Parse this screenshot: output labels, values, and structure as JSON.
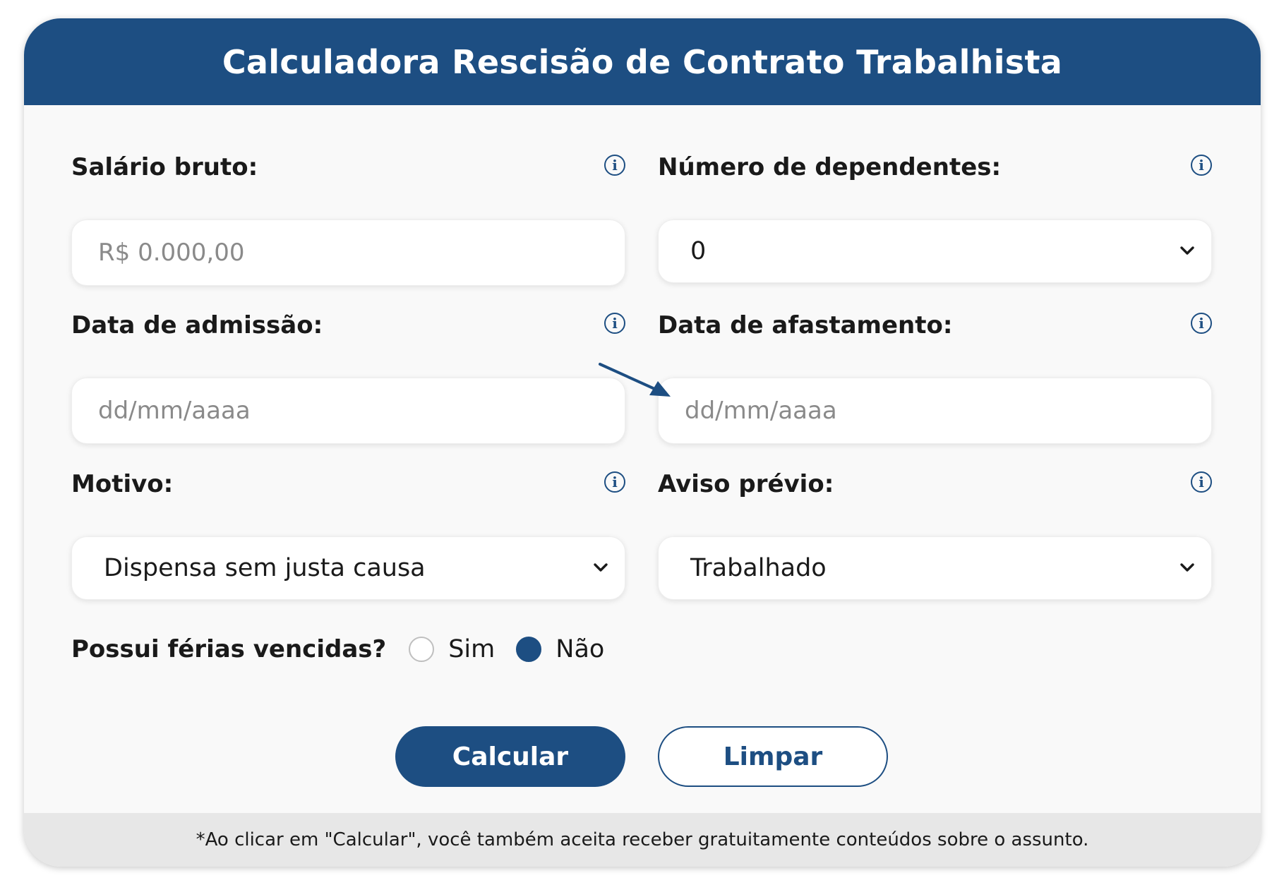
{
  "header": {
    "title": "Calculadora Rescisão de Contrato Trabalhista"
  },
  "fields": {
    "salario": {
      "label": "Salário bruto:",
      "placeholder": "R$ 0.000,00"
    },
    "dependentes": {
      "label": "Número de dependentes:",
      "selected": "0"
    },
    "admissao": {
      "label": "Data de admissão:",
      "placeholder": "dd/mm/aaaa"
    },
    "afastamento": {
      "label": "Data de afastamento:",
      "placeholder": "dd/mm/aaaa"
    },
    "motivo": {
      "label": "Motivo:",
      "selected": "Dispensa sem justa causa"
    },
    "aviso": {
      "label": "Aviso prévio:",
      "selected": "Trabalhado"
    }
  },
  "vencidas": {
    "label": "Possui férias vencidas?",
    "options": [
      {
        "label": "Sim",
        "checked": false
      },
      {
        "label": "Não",
        "checked": true
      }
    ]
  },
  "buttons": {
    "calcular": "Calcular",
    "limpar": "Limpar"
  },
  "footer": {
    "note": "*Ao clicar em \"Calcular\", você também aceita receber gratuitamente conteúdos sobre o assunto."
  },
  "icons": {
    "info": "info-icon",
    "chevron": "chevron-down-icon",
    "arrow": "arrow-annotation"
  },
  "colors": {
    "primary": "#1d4e82",
    "footer_bg": "#e7e7e7",
    "card_bg": "#f9f9f9"
  }
}
